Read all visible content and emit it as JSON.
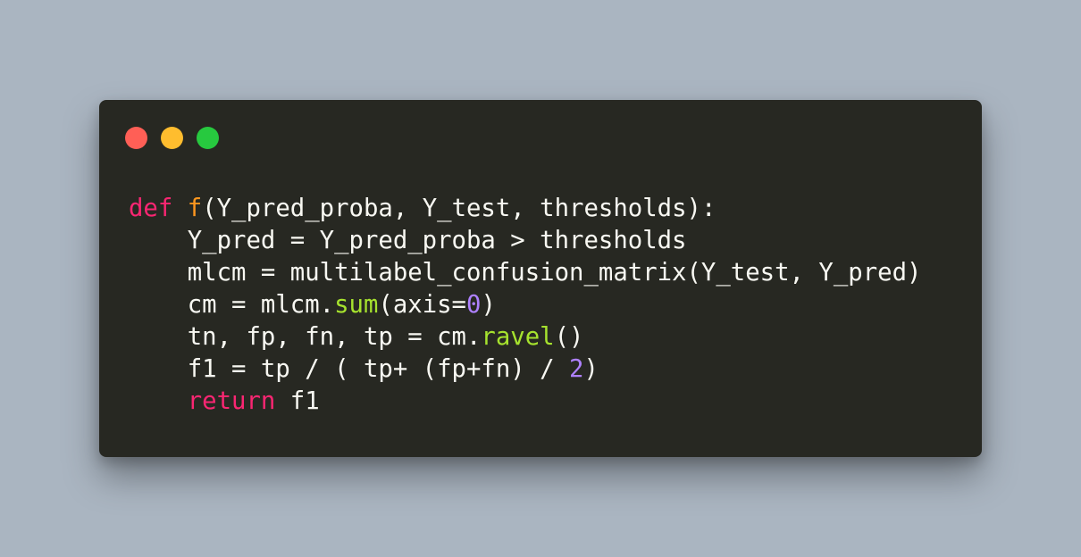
{
  "colors": {
    "background": "#aab5c1",
    "window": "#272822",
    "text": "#f8f8f2",
    "keyword": "#f92672",
    "function_name": "#fd971f",
    "method_call": "#a6e22e",
    "number": "#ae81ff",
    "close_light": "#ff5f56",
    "minimize_light": "#ffbd2e",
    "maximize_light": "#27c93f"
  },
  "window_controls": [
    "close",
    "minimize",
    "maximize"
  ],
  "code": {
    "line1": {
      "kw": "def",
      "name": "f",
      "rest": "(Y_pred_proba, Y_test, thresholds):"
    },
    "line2": {
      "text": "    Y_pred = Y_pred_proba > thresholds"
    },
    "line3": {
      "text": "    mlcm = multilabel_confusion_matrix(Y_test, Y_pred)"
    },
    "line4": {
      "a": "    cm = mlcm.",
      "call": "sum",
      "b": "(axis=",
      "num": "0",
      "c": ")"
    },
    "line5": {
      "a": "    tn, fp, fn, tp = cm.",
      "call": "ravel",
      "b": "()"
    },
    "line6": {
      "a": "    f1 = tp / ( tp+ (fp+fn) / ",
      "num": "2",
      "b": ")"
    },
    "line7": {
      "indent": "    ",
      "kw": "return",
      "rest": " f1"
    }
  }
}
